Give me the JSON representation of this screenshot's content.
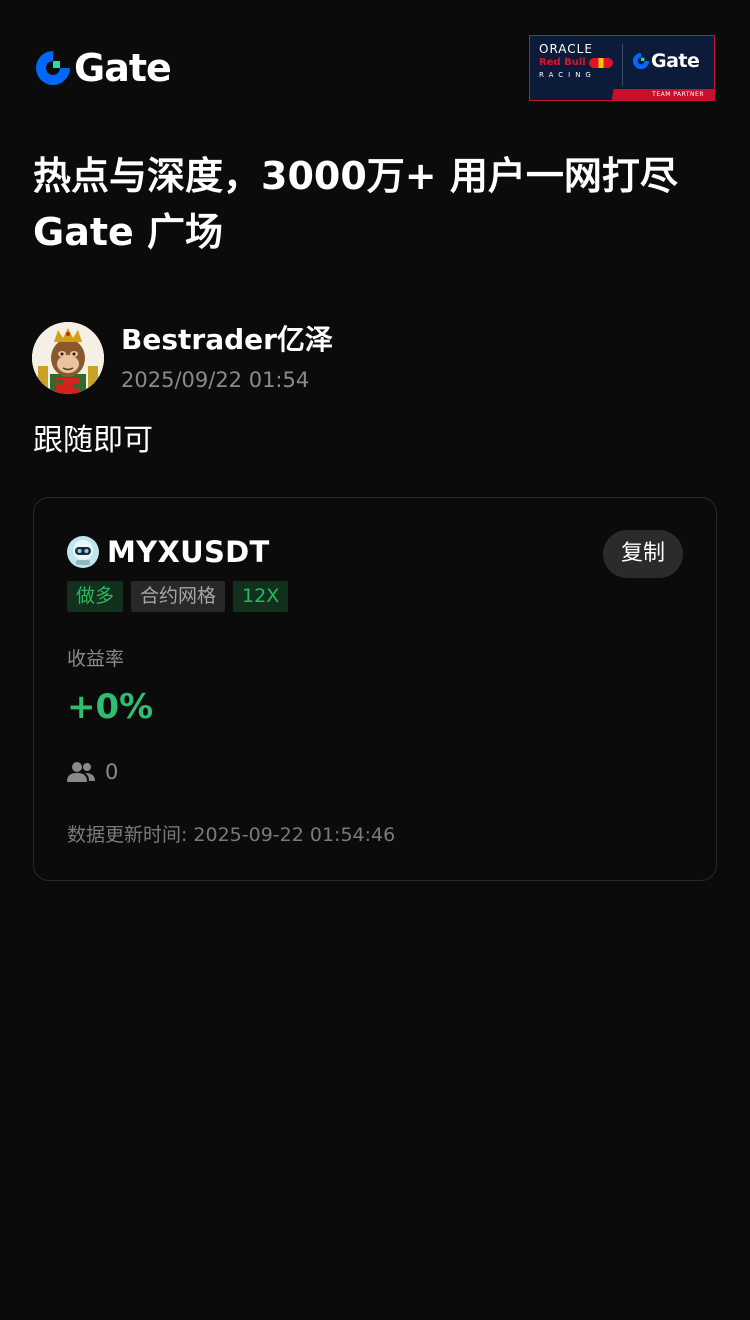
{
  "header": {
    "logo_text": "Gate",
    "partner_badge": {
      "line1": "ORACLE",
      "line2": "Red Bull",
      "line3": "RACING",
      "brand": "Gate",
      "footer": "TEAM PARTNER"
    }
  },
  "headline": {
    "line1": "热点与深度，3000万+ 用户一网打尽",
    "line2": "Gate 广场"
  },
  "post": {
    "author": "Bestrader亿泽",
    "time": "2025/09/22 01:54",
    "body": "跟随即可"
  },
  "strategy_card": {
    "symbol": "MYXUSDT",
    "copy_label": "复制",
    "tags": [
      "做多",
      "合约网格",
      "12X"
    ],
    "yield_label": "收益率",
    "yield_value": "+0%",
    "followers_count": "0",
    "update_label": "数据更新时间:",
    "update_time": "2025-09-22 01:54:46"
  },
  "colors": {
    "background": "#0b0b0b",
    "profit_green": "#2fbd72",
    "tag_green_text": "#2ab85e",
    "brand_blue": "#0068ff",
    "brand_green": "#17e6a1"
  },
  "icons": {
    "logo": "gate-logo-icon",
    "coin": "myx-coin-icon",
    "followers": "users-icon"
  }
}
